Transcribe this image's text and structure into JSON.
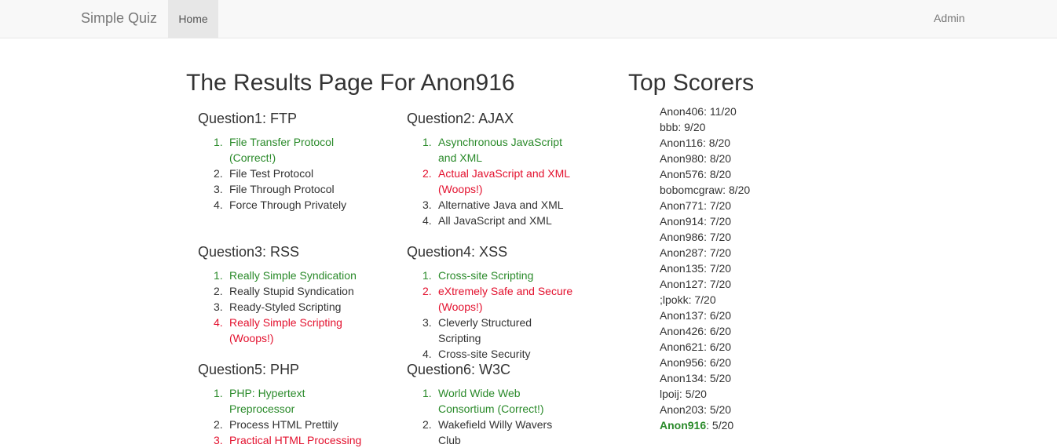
{
  "nav": {
    "brand": "Simple Quiz",
    "home": "Home",
    "admin": "Admin"
  },
  "colors": {
    "correct": "#2a8a2a",
    "wrong": "#e3112e"
  },
  "results": {
    "title": "The Results Page For Anon916",
    "questions": [
      {
        "title": "Question1: FTP",
        "answers": [
          {
            "num": "1.",
            "text": "File Transfer Protocol (Correct!)",
            "status": "correct"
          },
          {
            "num": "2.",
            "text": "File Test Protocol",
            "status": ""
          },
          {
            "num": "3.",
            "text": "File Through Protocol",
            "status": ""
          },
          {
            "num": "4.",
            "text": "Force Through Privately",
            "status": ""
          }
        ]
      },
      {
        "title": "Question2: AJAX",
        "answers": [
          {
            "num": "1.",
            "text": "Asynchronous JavaScript and XML",
            "status": "correct"
          },
          {
            "num": "2.",
            "text": "Actual JavaScript and XML (Woops!)",
            "status": "wrong"
          },
          {
            "num": "3.",
            "text": "Alternative Java and XML",
            "status": ""
          },
          {
            "num": "4.",
            "text": "All JavaScript and XML",
            "status": ""
          }
        ]
      },
      {
        "title": "Question3: RSS",
        "answers": [
          {
            "num": "1.",
            "text": "Really Simple Syndication",
            "status": "correct"
          },
          {
            "num": "2.",
            "text": "Really Stupid Syndication",
            "status": ""
          },
          {
            "num": "3.",
            "text": "Ready-Styled Scripting",
            "status": ""
          },
          {
            "num": "4.",
            "text": "Really Simple Scripting (Woops!)",
            "status": "wrong"
          }
        ]
      },
      {
        "title": "Question4: XSS",
        "answers": [
          {
            "num": "1.",
            "text": "Cross-site Scripting",
            "status": "correct"
          },
          {
            "num": "2.",
            "text": "eXtremely Safe and Secure (Woops!)",
            "status": "wrong"
          },
          {
            "num": "3.",
            "text": "Cleverly Structured Scripting",
            "status": ""
          },
          {
            "num": "4.",
            "text": "Cross-site Security",
            "status": ""
          }
        ]
      },
      {
        "title": "Question5: PHP",
        "answers": [
          {
            "num": "1.",
            "text": "PHP: Hypertext Preprocessor",
            "status": "correct"
          },
          {
            "num": "2.",
            "text": "Process HTML Prettily",
            "status": ""
          },
          {
            "num": "3.",
            "text": "Practical HTML Processing",
            "status": "wrong"
          }
        ]
      },
      {
        "title": "Question6: W3C",
        "answers": [
          {
            "num": "1.",
            "text": "World Wide Web Consortium (Correct!)",
            "status": "correct"
          },
          {
            "num": "2.",
            "text": "Wakefield Willy Wavers Club",
            "status": ""
          }
        ]
      }
    ]
  },
  "top_scorers": {
    "title": "Top Scorers",
    "current_user": "Anon916",
    "entries": [
      [
        "Anon406",
        "11/20"
      ],
      [
        "bbb",
        "9/20"
      ],
      [
        "Anon116",
        "8/20"
      ],
      [
        "Anon980",
        "8/20"
      ],
      [
        "Anon576",
        "8/20"
      ],
      [
        "bobomcgraw",
        "8/20"
      ],
      [
        "Anon771",
        "7/20"
      ],
      [
        "Anon914",
        "7/20"
      ],
      [
        "Anon986",
        "7/20"
      ],
      [
        "Anon287",
        "7/20"
      ],
      [
        "Anon135",
        "7/20"
      ],
      [
        "Anon127",
        "7/20"
      ],
      [
        ";lpokk",
        "7/20"
      ],
      [
        "Anon137",
        "6/20"
      ],
      [
        "Anon426",
        "6/20"
      ],
      [
        "Anon621",
        "6/20"
      ],
      [
        "Anon956",
        "6/20"
      ],
      [
        "Anon134",
        "5/20"
      ],
      [
        "lpoij",
        "5/20"
      ],
      [
        "Anon203",
        "5/20"
      ],
      [
        "Anon916",
        "5/20"
      ]
    ]
  }
}
